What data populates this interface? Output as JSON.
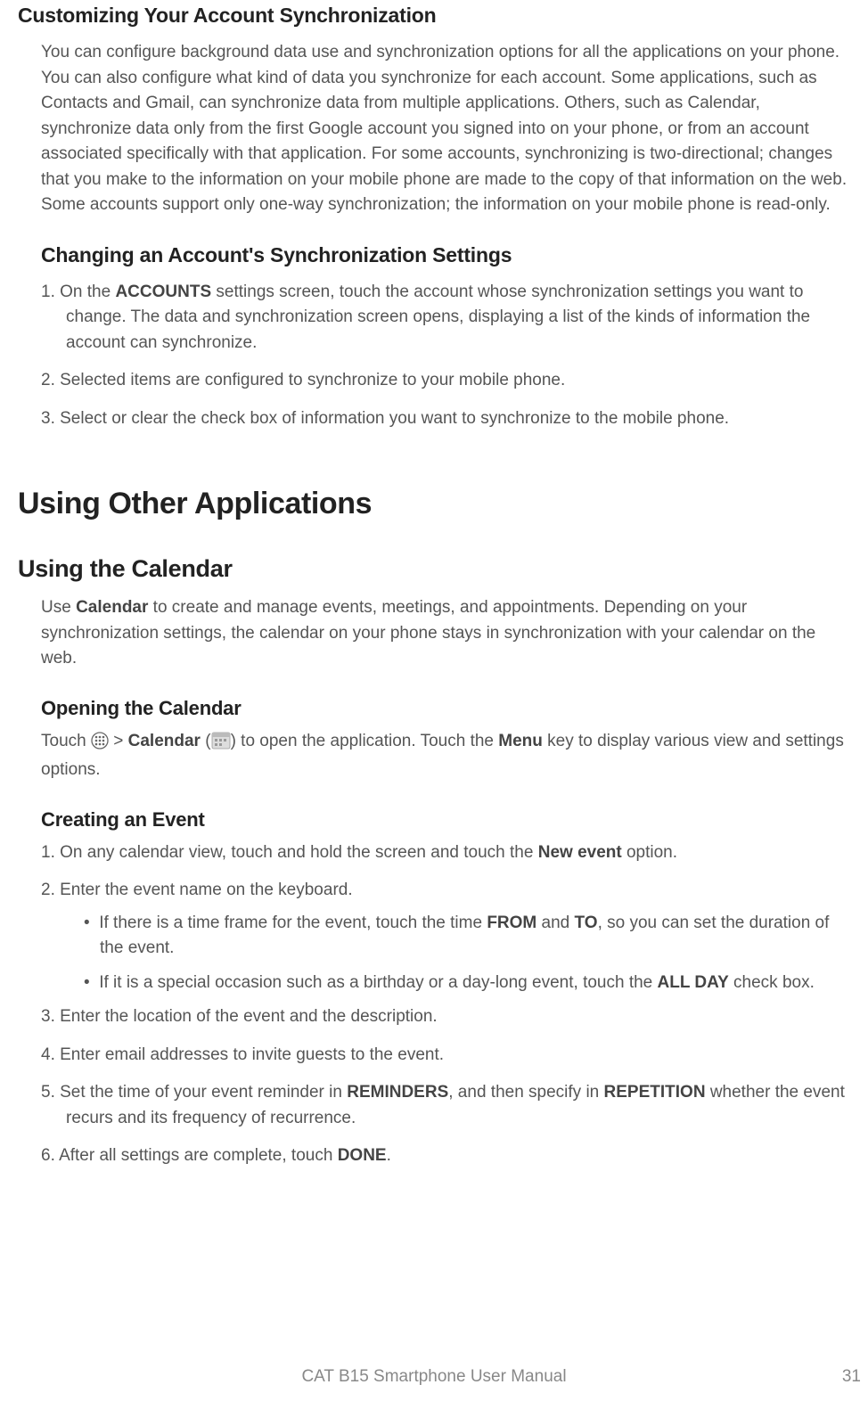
{
  "section1": {
    "title": "Customizing Your Account Synchronization",
    "intro": "You can configure background data use and synchronization options for all the applications on your phone. You can also configure what kind of data you synchronize for each account. Some applications, such as Contacts and Gmail, can synchronize data from multiple applications. Others, such as Calendar, synchronize data only from the first Google account you signed into on your phone, or from an account associated specifically with that application. For some accounts, synchronizing is two-directional; changes that you make to the information on your mobile phone are made to the copy of that information on the web. Some accounts support only one-way synchronization; the information on your mobile phone is read-only."
  },
  "section2": {
    "title": "Changing an Account's Synchronization Settings",
    "step1_prefix": "1. On the ",
    "step1_bold": "ACCOUNTS",
    "step1_suffix": " settings screen, touch the account whose synchronization settings you want to change. The data and synchronization screen opens, displaying a list of the kinds of information the account can synchronize.",
    "step2": "2. Selected items are configured to synchronize to your mobile phone.",
    "step3": "3. Select or clear the check box of information you want to synchronize to the mobile phone."
  },
  "chapter": {
    "title": "Using Other Applications"
  },
  "section3": {
    "title": "Using the Calendar",
    "intro_prefix": "Use ",
    "intro_bold": "Calendar",
    "intro_suffix": " to create and manage events, meetings, and appointments. Depending on your synchronization settings, the calendar on your phone stays in synchronization with your calendar on the web."
  },
  "section4": {
    "title": "Opening the Calendar",
    "text_prefix": "Touch ",
    "text_mid1": " > ",
    "text_bold1": "Calendar",
    "text_mid2": " (",
    "text_mid3": ") to open the application. Touch the ",
    "text_bold2": "Menu",
    "text_suffix": " key to display various view and settings options."
  },
  "section5": {
    "title": "Creating an Event",
    "step1_prefix": "1. On any calendar view, touch and hold the screen and touch the ",
    "step1_bold": "New event",
    "step1_suffix": " option.",
    "step2": "2. Enter the event name on the keyboard.",
    "bullet1_prefix": "If there is a time frame for the event, touch the time ",
    "bullet1_bold1": "FROM",
    "bullet1_mid": " and ",
    "bullet1_bold2": "TO",
    "bullet1_suffix": ", so you can set the duration of the event.",
    "bullet2_prefix": "If it is a special occasion such as a birthday or a day-long event, touch the ",
    "bullet2_bold": "ALL DAY",
    "bullet2_suffix": " check box.",
    "step3": "3. Enter the location of the event and the description.",
    "step4": "4. Enter email addresses to invite guests to the event.",
    "step5_prefix": "5. Set the time of your event reminder in ",
    "step5_bold1": "REMINDERS",
    "step5_mid": ", and then specify in ",
    "step5_bold2": "REPETITION",
    "step5_suffix": " whether the event recurs and its frequency of recurrence.",
    "step6_prefix": "6. After all settings are complete, touch ",
    "step6_bold": "DONE",
    "step6_suffix": "."
  },
  "footer": {
    "text": "CAT B15 Smartphone User Manual",
    "page": "31"
  }
}
